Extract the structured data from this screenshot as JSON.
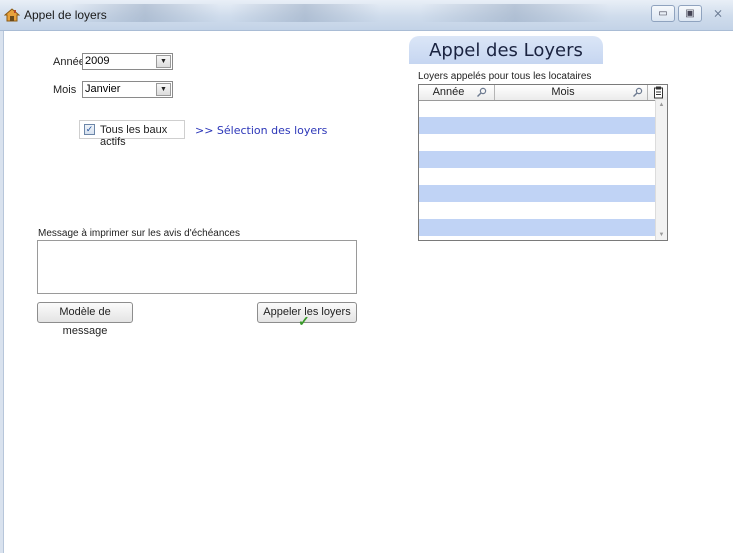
{
  "window": {
    "title": "Appel de loyers",
    "minimize_glyph": "▭",
    "maximize_glyph": "▣",
    "close_glyph": "⨯"
  },
  "form": {
    "annee_label": "Année",
    "annee_value": "2009",
    "mois_label": "Mois",
    "mois_value": "Janvier",
    "tous_baux_label": "Tous les baux actifs",
    "tous_baux_checked": true,
    "selection_link": ">> Sélection des loyers",
    "message_label": "Message à imprimer sur les avis d'échéances",
    "message_value": "",
    "modele_button": "Modèle de message",
    "appeler_button": "Appeler les loyers"
  },
  "panel": {
    "title": "Appel des Loyers",
    "grid_caption": "Loyers appelés pour tous les locataires",
    "columns": [
      "Année",
      "Mois"
    ],
    "rows": []
  },
  "colors": {
    "row_alt": "#c0d3f5",
    "link": "#2b36b8",
    "panel_header": "#c6d6f1",
    "check": "#3a9a2a"
  },
  "icons": {
    "app": "house-icon",
    "column_filter": "search-icon",
    "grid_menu": "clipboard-icon",
    "checkmark": "checkmark-icon"
  }
}
